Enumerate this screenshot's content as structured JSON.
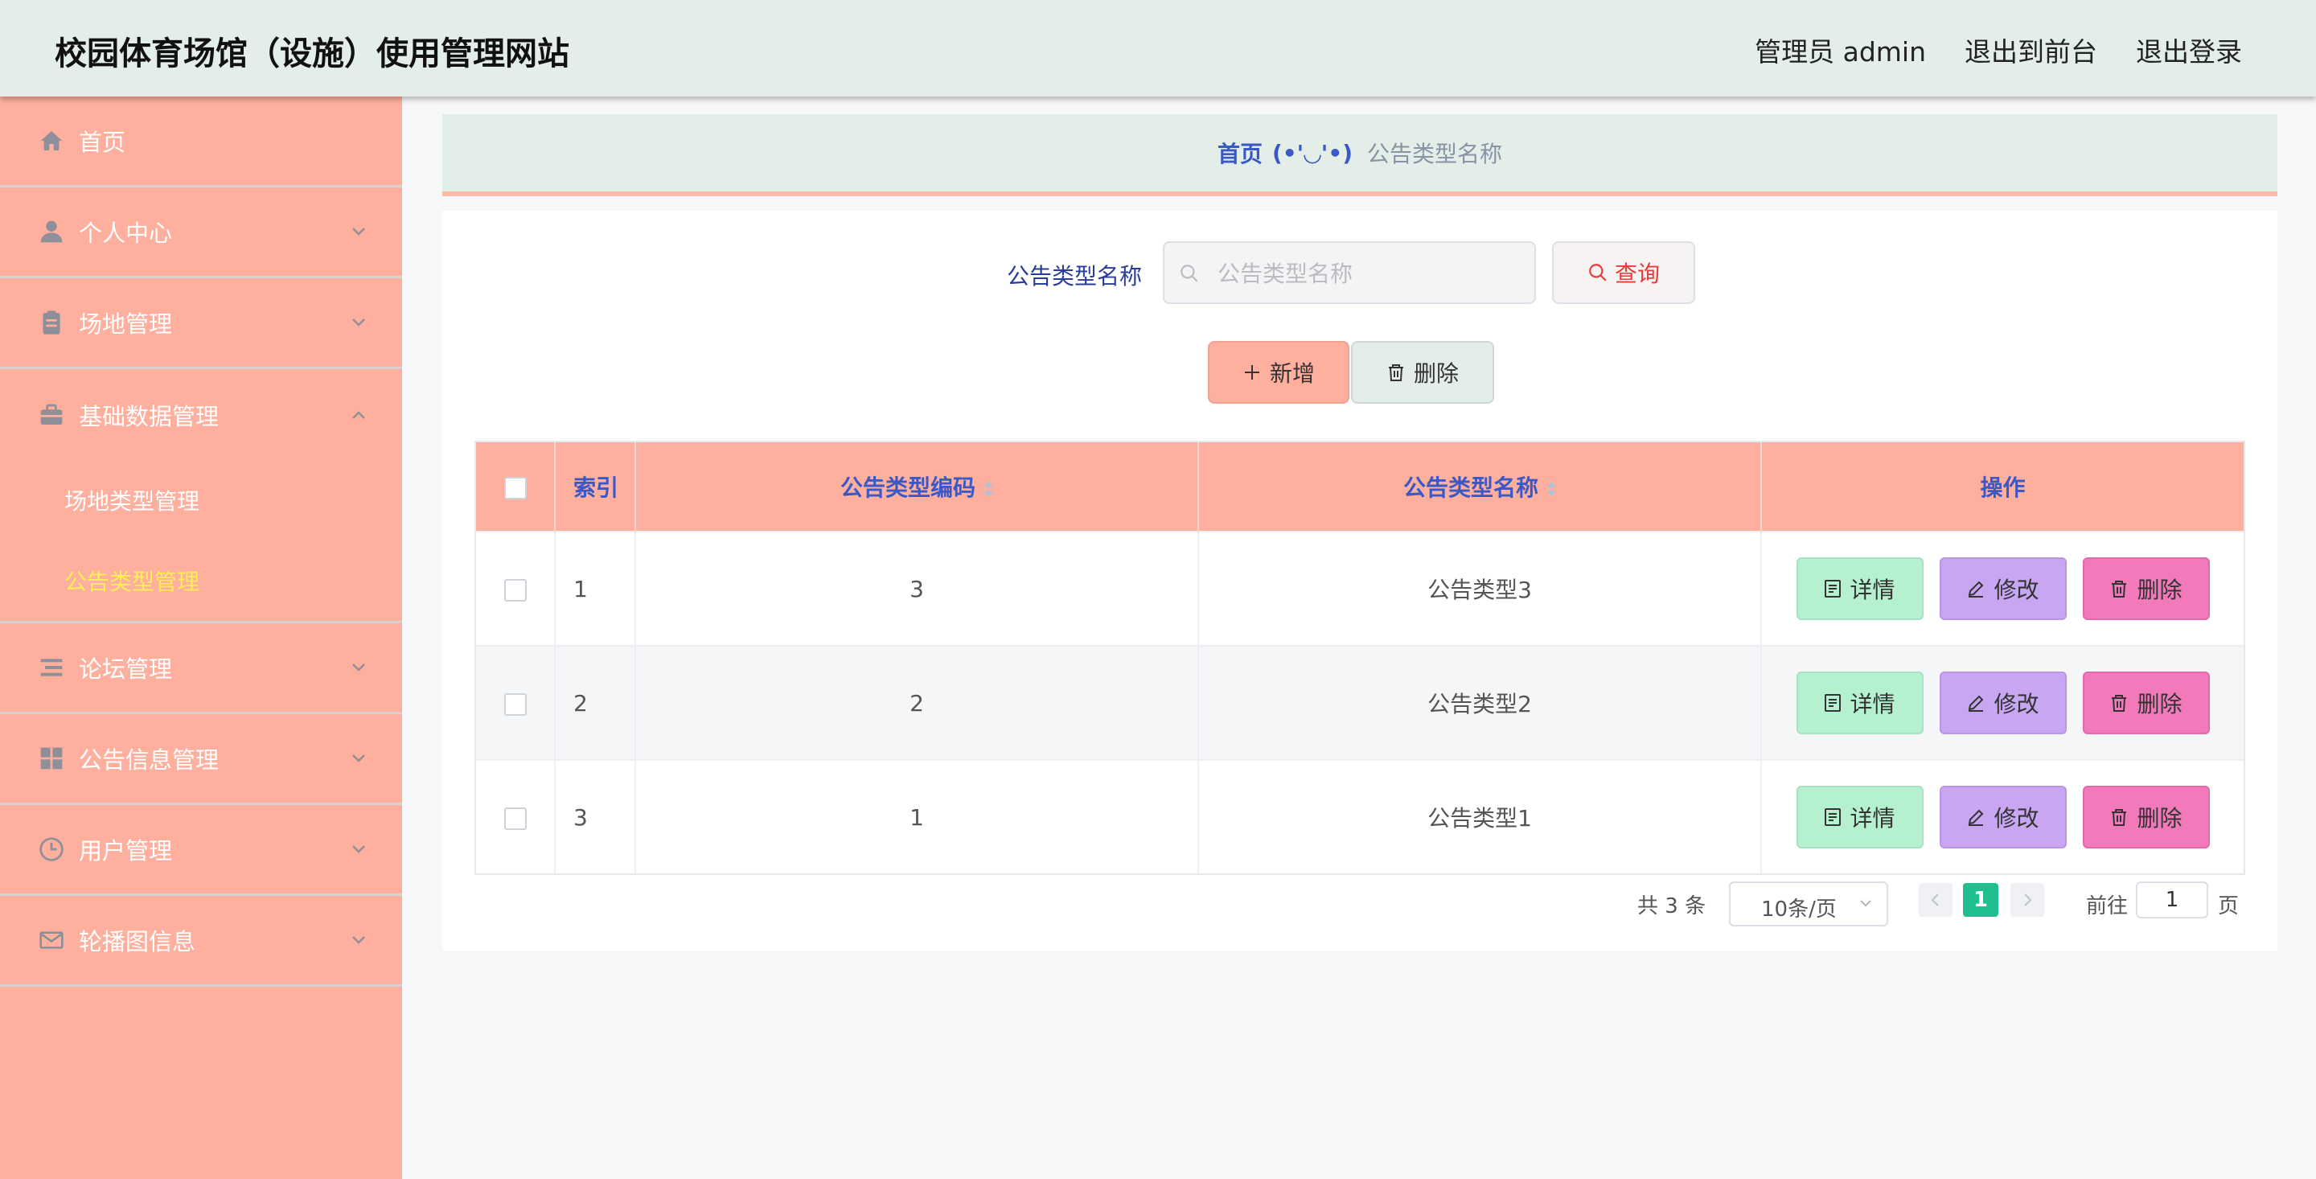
{
  "header": {
    "title": "校园体育场馆（设施）使用管理网站",
    "admin_label": "管理员 admin",
    "exit_front": "退出到前台",
    "logout": "退出登录"
  },
  "sidebar": {
    "items": [
      {
        "label": "首页",
        "icon": "home-icon"
      },
      {
        "label": "个人中心",
        "icon": "user-icon"
      },
      {
        "label": "场地管理",
        "icon": "clipboard-icon"
      },
      {
        "label": "基础数据管理",
        "icon": "briefcase-icon",
        "expanded": true,
        "children": [
          {
            "label": "场地类型管理"
          },
          {
            "label": "公告类型管理",
            "active": true
          }
        ]
      },
      {
        "label": "论坛管理",
        "icon": "list-icon"
      },
      {
        "label": "公告信息管理",
        "icon": "grid-icon"
      },
      {
        "label": "用户管理",
        "icon": "clock-icon"
      },
      {
        "label": "轮播图信息",
        "icon": "mail-icon"
      }
    ]
  },
  "breadcrumb": {
    "home": "首页",
    "separator": "(•'◡'•)",
    "current": "公告类型名称"
  },
  "search": {
    "label": "公告类型名称",
    "placeholder": "公告类型名称",
    "query_button": "查询"
  },
  "actions": {
    "add": "新增",
    "delete": "删除"
  },
  "table": {
    "headers": {
      "index": "索引",
      "code": "公告类型编码",
      "name": "公告类型名称",
      "ops": "操作"
    },
    "rows": [
      {
        "index": "1",
        "code": "3",
        "name": "公告类型3"
      },
      {
        "index": "2",
        "code": "2",
        "name": "公告类型2"
      },
      {
        "index": "3",
        "code": "1",
        "name": "公告类型1"
      }
    ],
    "row_actions": {
      "detail": "详情",
      "edit": "修改",
      "delete": "删除"
    }
  },
  "pagination": {
    "total": "共 3 条",
    "page_size": "10条/页",
    "current_page": "1",
    "goto_label": "前往",
    "goto_value": "1",
    "goto_unit": "页"
  },
  "colors": {
    "header_bg": "#e2eee7",
    "sidebar_bg": "#ffaf9e",
    "active_submenu": "#ffee58",
    "accent_blue": "#3b58c7",
    "page_active": "#1fbf8f"
  }
}
